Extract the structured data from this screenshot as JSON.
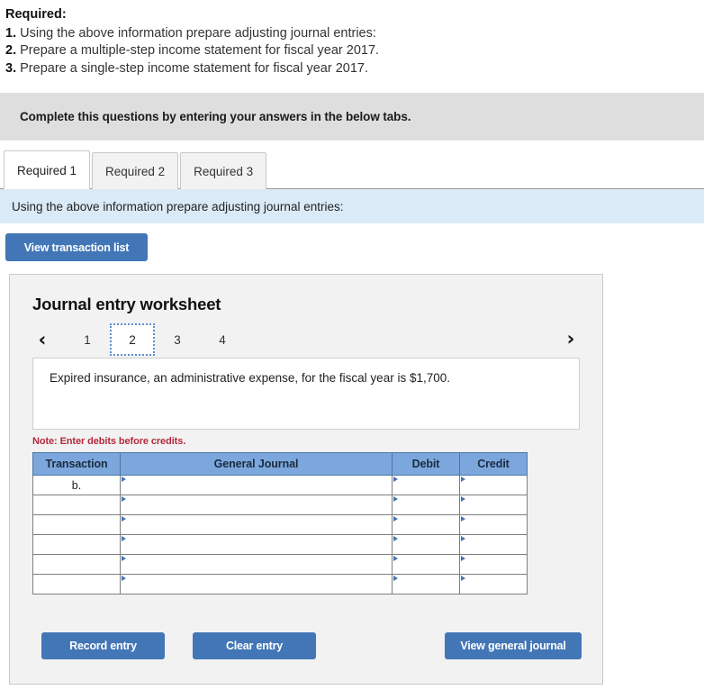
{
  "required": {
    "title": "Required:",
    "items": [
      {
        "num": "1.",
        "text": "Using the above information prepare adjusting journal entries:"
      },
      {
        "num": "2.",
        "text": "Prepare a multiple-step income statement for fiscal year 2017."
      },
      {
        "num": "3.",
        "text": "Prepare a single-step income statement for fiscal year 2017."
      }
    ]
  },
  "instruction_bar": {
    "text": "Complete this questions by entering your answers in the below tabs."
  },
  "tabs": [
    {
      "label": "Required 1",
      "active": true
    },
    {
      "label": "Required 2",
      "active": false
    },
    {
      "label": "Required 3",
      "active": false
    }
  ],
  "sub_instruction": {
    "text": "Using the above information prepare adjusting journal entries:"
  },
  "buttons": {
    "view_transaction_list": "View transaction list",
    "record_entry": "Record entry",
    "clear_entry": "Clear entry",
    "view_general_journal": "View general journal"
  },
  "worksheet": {
    "title": "Journal entry worksheet",
    "pager": {
      "prev_icon": "chevron-left",
      "next_icon": "chevron-right",
      "pages": [
        "1",
        "2",
        "3",
        "4"
      ],
      "selected": "2"
    },
    "event_text": "Expired insurance, an administrative expense, for the fiscal year is $1,700.",
    "note": "Note: Enter debits before credits.",
    "table": {
      "headers": [
        "Transaction",
        "General Journal",
        "Debit",
        "Credit"
      ],
      "rows": [
        {
          "transaction": "b.",
          "general_journal": "",
          "debit": "",
          "credit": ""
        },
        {
          "transaction": "",
          "general_journal": "",
          "debit": "",
          "credit": ""
        },
        {
          "transaction": "",
          "general_journal": "",
          "debit": "",
          "credit": ""
        },
        {
          "transaction": "",
          "general_journal": "",
          "debit": "",
          "credit": ""
        },
        {
          "transaction": "",
          "general_journal": "",
          "debit": "",
          "credit": ""
        },
        {
          "transaction": "",
          "general_journal": "",
          "debit": "",
          "credit": ""
        }
      ]
    }
  },
  "colors": {
    "accent_blue": "#4276b6",
    "table_header_blue": "#7ba7dd",
    "info_blue": "#daeaf7",
    "instruction_gray": "#dedede",
    "note_red": "#b3293c"
  }
}
